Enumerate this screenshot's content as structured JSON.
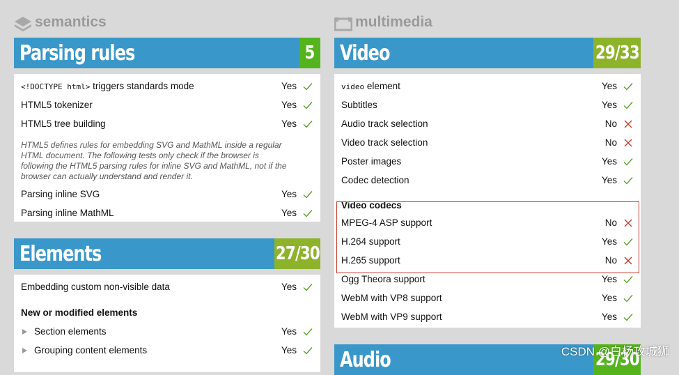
{
  "left": {
    "category": "semantics",
    "parsing": {
      "title": "Parsing rules",
      "score": "5",
      "rows": [
        {
          "code": "<!DOCTYPE html>",
          "label": " triggers standards mode",
          "result": "Yes",
          "ok": true
        },
        {
          "label": "HTML5 tokenizer",
          "result": "Yes",
          "ok": true
        },
        {
          "label": "HTML5 tree building",
          "result": "Yes",
          "ok": true
        }
      ],
      "note": "HTML5 defines rules for embedding SVG and MathML inside a regular HTML document. The following tests only check if the browser is following the HTML5 parsing rules for inline SVG and MathML, not if the browser can actually understand and render it.",
      "rows2": [
        {
          "label": "Parsing inline SVG",
          "result": "Yes",
          "ok": true
        },
        {
          "label": "Parsing inline MathML",
          "result": "Yes",
          "ok": true
        }
      ]
    },
    "elements": {
      "title": "Elements",
      "score": "27/30",
      "rows": [
        {
          "label": "Embedding custom non-visible data",
          "result": "Yes",
          "ok": true
        }
      ],
      "subhead": "New or modified elements",
      "rows2": [
        {
          "label": "Section elements",
          "result": "Yes",
          "ok": true
        },
        {
          "label": "Grouping content elements",
          "result": "Yes",
          "ok": true
        }
      ]
    }
  },
  "right": {
    "category": "multimedia",
    "video": {
      "title": "Video",
      "score": "29/33",
      "rows": [
        {
          "code": "video",
          "label": " element",
          "result": "Yes",
          "ok": true
        },
        {
          "label": "Subtitles",
          "result": "Yes",
          "ok": true
        },
        {
          "label": "Audio track selection",
          "result": "No",
          "ok": false
        },
        {
          "label": "Video track selection",
          "result": "No",
          "ok": false
        },
        {
          "label": "Poster images",
          "result": "Yes",
          "ok": true
        },
        {
          "label": "Codec detection",
          "result": "Yes",
          "ok": true
        }
      ],
      "subhead": "Video codecs",
      "rows2": [
        {
          "label": "MPEG-4 ASP support",
          "result": "No",
          "ok": false
        },
        {
          "label": "H.264 support",
          "result": "Yes",
          "ok": true
        },
        {
          "label": "H.265 support",
          "result": "No",
          "ok": false
        },
        {
          "label": "Ogg Theora support",
          "result": "Yes",
          "ok": true
        },
        {
          "label": "WebM with VP8 support",
          "result": "Yes",
          "ok": true
        },
        {
          "label": "WebM with VP9 support",
          "result": "Yes",
          "ok": true
        }
      ]
    },
    "audio": {
      "title": "Audio",
      "score": "29/30"
    }
  },
  "watermark": "CSDN @白杨攻城狮",
  "colors": {
    "bar_blue": "#3a97c9",
    "score_green": "#55b31e",
    "score_olive": "#8db32b",
    "check": "#5aa02c",
    "cross": "#c0392b",
    "highlight": "#c0392b"
  }
}
